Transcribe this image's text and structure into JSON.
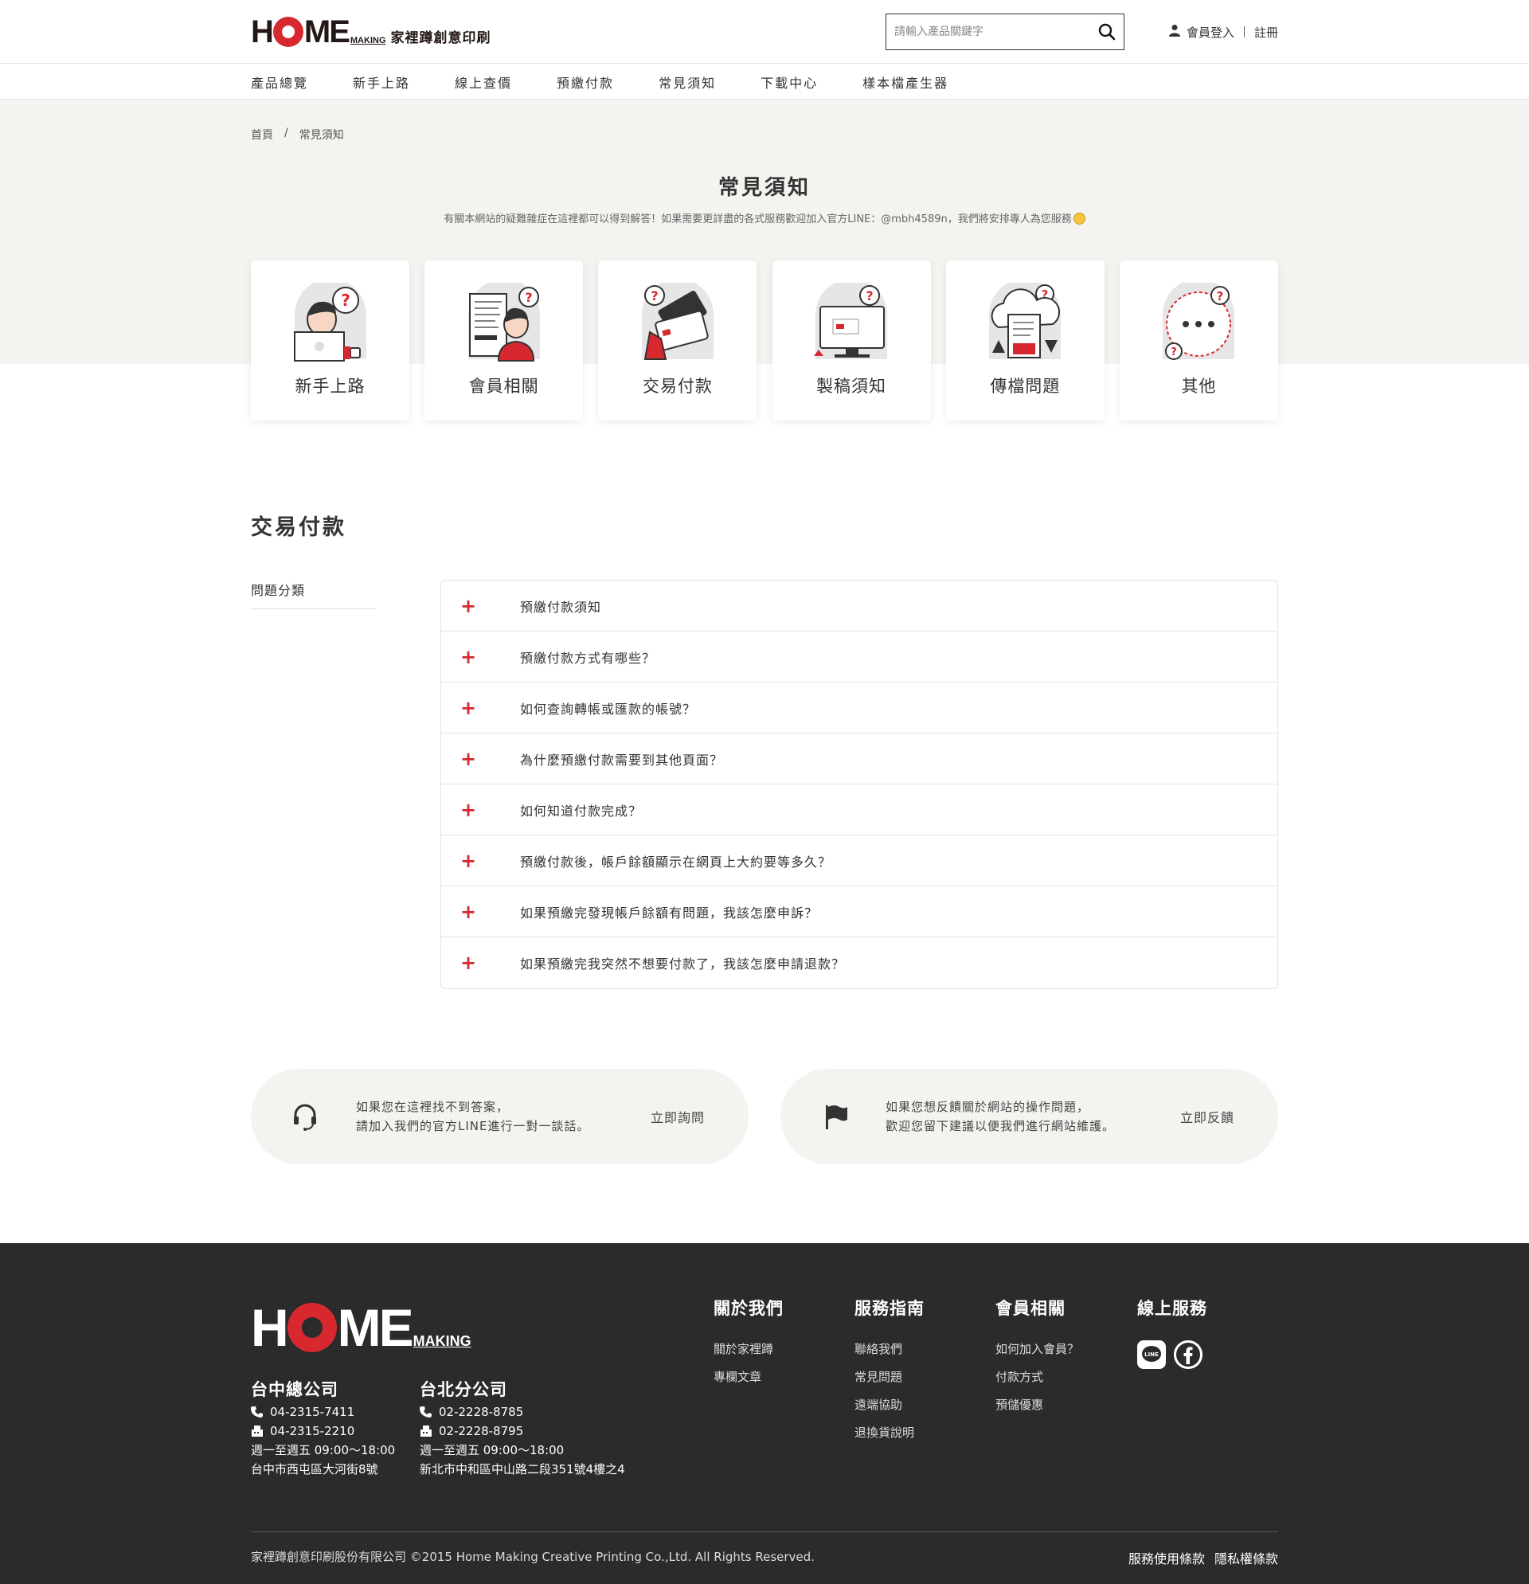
{
  "brand": {
    "logo_word_h": "H",
    "logo_word_me": "ME",
    "logo_making": "MAKING",
    "logo_reg": "®",
    "logo_cn": "家裡蹲創意印刷"
  },
  "header": {
    "search_placeholder": "請輸入產品關鍵字",
    "login": "會員登入",
    "register": "註冊"
  },
  "nav": [
    "產品總覽",
    "新手上路",
    "線上查價",
    "預繳付款",
    "常見須知",
    "下載中心",
    "樣本檔產生器"
  ],
  "breadcrumb": {
    "home": "首頁",
    "sep": "/",
    "current": "常見須知"
  },
  "page": {
    "title": "常見須知",
    "subtitle": "有關本網站的疑難雜症在這裡都可以得到解答！如果需要更詳盡的各式服務歡迎加入官方LINE：@mbh4589n，我們將安排專人為您服務"
  },
  "categories": [
    "新手上路",
    "會員相關",
    "交易付款",
    "製稿須知",
    "傳檔問題",
    "其他"
  ],
  "section": {
    "title": "交易付款",
    "side_label": "問題分類",
    "faqs": [
      "預繳付款須知",
      "預繳付款方式有哪些？",
      "如何查詢轉帳或匯款的帳號？",
      "為什麼預繳付款需要到其他頁面？",
      "如何知道付款完成？",
      "預繳付款後，帳戶餘額顯示在網頁上大約要等多久？",
      "如果預繳完發現帳戶餘額有問題，我該怎麼申訴？",
      "如果預繳完我突然不想要付款了，我該怎麼申請退款？"
    ]
  },
  "help": [
    {
      "line1": "如果您在這裡找不到答案，",
      "line2": "請加入我們的官方LINE進行一對一談話。",
      "action": "立即詢問",
      "icon": "headset-icon"
    },
    {
      "line1": "如果您想反饋關於網站的操作問題，",
      "line2": "歡迎您留下建議以便我們進行網站維護。",
      "action": "立即反饋",
      "icon": "flag-icon"
    }
  ],
  "footer": {
    "offices": [
      {
        "name": "台中總公司",
        "phone": "04-2315-7411",
        "fax": "04-2315-2210",
        "hours": "週一至週五 09:00～18:00",
        "address": "台中市西屯區大河街8號"
      },
      {
        "name": "台北分公司",
        "phone": "02-2228-8785",
        "fax": "02-2228-8795",
        "hours": "週一至週五 09:00～18:00",
        "address": "新北市中和區中山路二段351號4樓之4"
      }
    ],
    "columns": [
      {
        "title": "關於我們",
        "links": [
          "關於家裡蹲",
          "專欄文章"
        ]
      },
      {
        "title": "服務指南",
        "links": [
          "聯絡我們",
          "常見問題",
          "遠端協助",
          "退換貨說明"
        ]
      },
      {
        "title": "會員相關",
        "links": [
          "如何加入會員？",
          "付款方式",
          "預儲優惠"
        ]
      },
      {
        "title": "線上服務",
        "links": []
      }
    ],
    "copyright": "家裡蹲創意印刷股份有限公司 ©2015 Home Making Creative Printing Co.,Ltd. All Rights Reserved.",
    "terms": "服務使用條款",
    "privacy": "隱私權條款",
    "line_badge": "LINE"
  },
  "colors": {
    "accent": "#d7282f",
    "hero_bg": "#f5f3f0",
    "footer_bg": "#2b2b2b"
  }
}
